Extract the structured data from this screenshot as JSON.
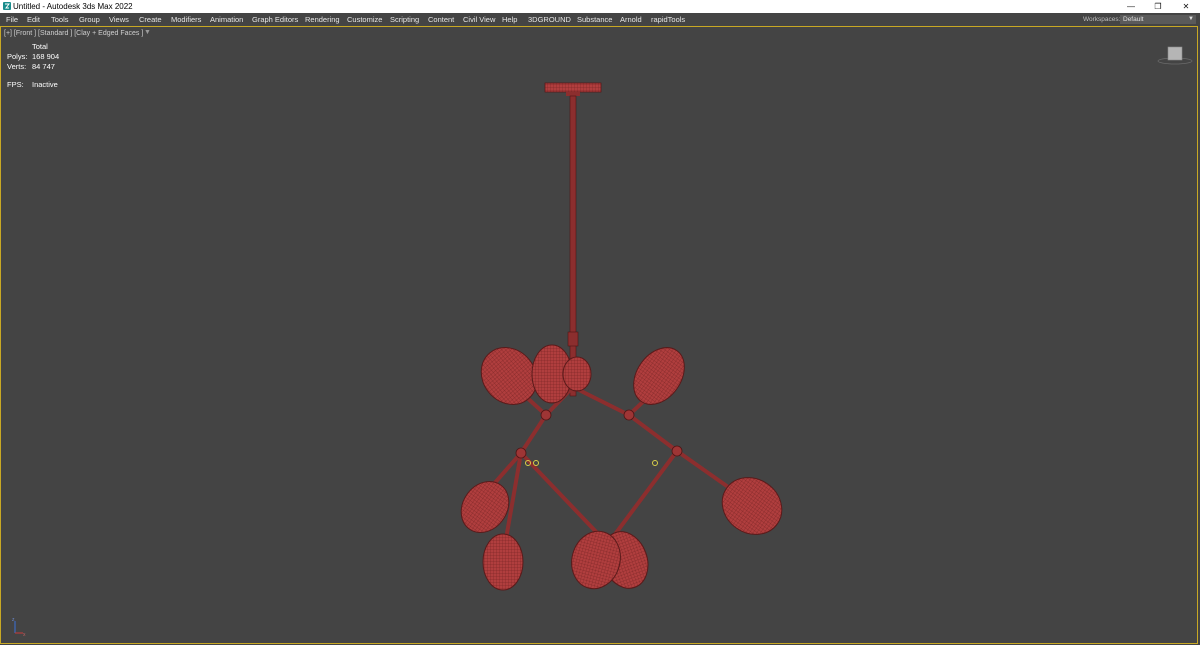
{
  "titlebar": {
    "title": "Untitled - Autodesk 3ds Max 2022",
    "minimize_glyph": "—",
    "restore_glyph": "❐",
    "close_glyph": "✕"
  },
  "menubar": {
    "items": [
      "File",
      "Edit",
      "Tools",
      "Group",
      "Views",
      "Create",
      "Modifiers",
      "Animation",
      "Graph Editors",
      "Rendering",
      "Customize",
      "Scripting",
      "Content",
      "Civil View",
      "Help",
      "3DGROUND",
      "Substance",
      "Arnold",
      "rapidTools"
    ],
    "workspaces_label": "Workspaces:",
    "workspace_value": "Default"
  },
  "viewport": {
    "label": "[+] [Front ] [Standard ] [Clay + Edged Faces ]",
    "filter_glyph": "▼",
    "stats": {
      "total_label": "Total",
      "polys_label": "Polys:",
      "polys_value": "168 904",
      "verts_label": "Verts:",
      "verts_value": "84 747",
      "fps_label": "FPS:",
      "fps_value": "Inactive"
    },
    "border_color": "#c8a824",
    "model_color": "#a83b3b"
  },
  "icons": {
    "app": "3dsmax-app-icon",
    "viewcube": "viewcube-icon",
    "axis": "axis-tripod-icon"
  }
}
